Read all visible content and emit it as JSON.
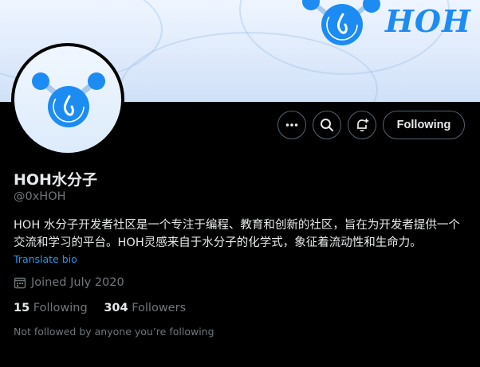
{
  "banner": {
    "logo_text": "HOH"
  },
  "profile": {
    "display_name": "HOH水分子",
    "handle": "@0xHOH",
    "bio": "HOH 水分子开发者社区是一个专注于编程、教育和创新的社区，旨在为开发者提供一个交流和学习的平台。HOH灵感来自于水分子的化学式，象征着流动性和生命力。",
    "translate_label": "Translate bio",
    "joined": "Joined July 2020",
    "following_count": "15",
    "following_label": "Following",
    "followers_count": "304",
    "followers_label": "Followers",
    "not_followed_text": "Not followed by anyone you’re following"
  },
  "actions": {
    "more_icon": "more-icon",
    "search_icon": "search-icon",
    "notify_icon": "bell-plus-icon",
    "following_button_label": "Following"
  },
  "colors": {
    "brand_blue": "#1d8cf2",
    "link_blue": "#1d9bf0",
    "muted": "#71767b",
    "border": "#536471"
  }
}
